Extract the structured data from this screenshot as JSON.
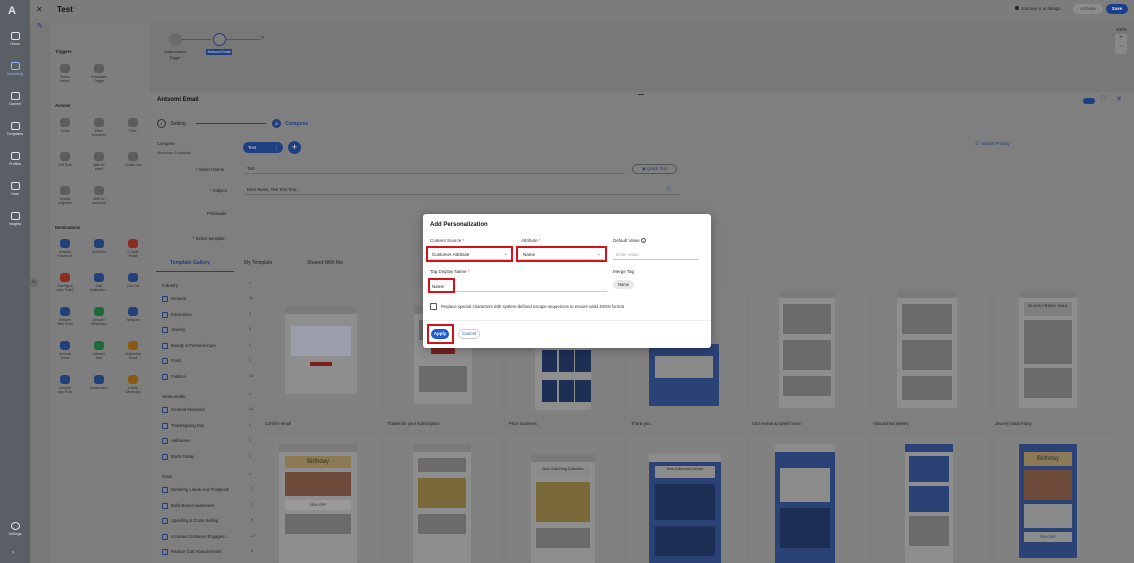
{
  "rail": {
    "items": [
      {
        "label": "Home",
        "icon": "home-icon"
      },
      {
        "label": "Marketing",
        "icon": "marketing-icon",
        "active": true
      },
      {
        "label": "Content",
        "icon": "content-icon"
      },
      {
        "label": "Templates",
        "icon": "templates-icon"
      },
      {
        "label": "Profiles",
        "icon": "profiles-icon"
      },
      {
        "label": "Data",
        "icon": "data-icon"
      },
      {
        "label": "Insights",
        "icon": "insights-icon"
      }
    ],
    "settings_label": "Settings"
  },
  "header": {
    "title": "Test",
    "tooltip": "Test",
    "status": "Journey is in design",
    "activate_label": "Activate",
    "save_label": "Save",
    "zoom": "100%"
  },
  "canvas_nodes": [
    {
      "label": "Action Based\nTrigger"
    },
    {
      "label": "Antsomi Email"
    }
  ],
  "palette": {
    "triggers_title": "Triggers",
    "triggers": [
      "Action\nbased",
      "Scheduled\nTrigger"
    ],
    "actions_title": "Actions",
    "actions": [
      "Delay",
      "Either\nbranches",
      "Filter",
      "A/B Split",
      "Wait for\nevent",
      "Update info",
      "Update\nsegment",
      "Wait for\nresponse"
    ],
    "destinations_title": "Destinations",
    "destinations": [
      "Antsomi\nFacebook",
      "SendGrid",
      "G Suite\nEmail",
      "OneSignal\n(App Push)",
      "Zalo\nNotificatio...",
      "Zalo OA",
      "Antsomi\nWeb Push",
      "Antsomi\nWhatsApp",
      "Telegram",
      "Antsomi\nEmail",
      "Antsomi\nLine",
      "Mailchimp\nEmail",
      "Antsomi\nApp Push",
      "Smart Inbox",
      "Infobip\nWhatsapp"
    ]
  },
  "email_panel": {
    "title": "Antsomi Email",
    "step1": "Setting",
    "step2": "Compose",
    "compose_label": "Compose",
    "compose_sub": "Maximum 5 variants",
    "variant_tab": "Test",
    "variant_priority": "Variant Priority",
    "variant_name_label": "* Variant Name",
    "variant_name_value": "Test",
    "quick_test": "Quick Test",
    "subject_label": "* Subject",
    "subject_value": "Dear Name, Test Test Test...",
    "preheader_label": "Preheader",
    "select_template_label": "* Select template",
    "tabs": [
      "Template Gallery",
      "My Template",
      "Shared With Me"
    ]
  },
  "filters": {
    "industry_title": "Industry",
    "industry": [
      {
        "label": "General",
        "count": "10"
      },
      {
        "label": "Electronics",
        "count": "1"
      },
      {
        "label": "Jewelry",
        "count": "3"
      },
      {
        "label": "Beauty & Personal Care",
        "count": "1"
      },
      {
        "label": "Food",
        "count": "1"
      },
      {
        "label": "Fashion",
        "count": "10"
      }
    ],
    "seasonality_title": "Seasonality",
    "seasonality": [
      {
        "label": "General Seasonal",
        "count": "24"
      },
      {
        "label": "Thanksgiving Day",
        "count": "1"
      },
      {
        "label": "Halloween",
        "count": "1"
      },
      {
        "label": "Black Friday",
        "count": "1"
      }
    ],
    "goal_title": "Goal",
    "goal": [
      {
        "label": "Nurturing Leads And Prospects",
        "count": "7"
      },
      {
        "label": "Build Brand Awareness",
        "count": "7"
      },
      {
        "label": "Upselling & Cross-Selling",
        "count": "9"
      },
      {
        "label": "Increase Customer Engagem...",
        "count": "17"
      },
      {
        "label": "Reduce Cart Abandonment",
        "count": "5"
      }
    ]
  },
  "templates_row1": [
    "Confirm email",
    "Thanks for your subscription",
    "Price madness",
    "Thank you",
    "Cart revival & upsell boost",
    "Abandoned jewelry",
    "Jewelry black friday"
  ],
  "thumb_texts": {
    "black_friday": "BLACK FRIDAY SALE",
    "birthday": "Birthday",
    "gold_ring": "New Gold Ring Collection",
    "new_collection": "New Collection Launch",
    "off_25": "25% OFF",
    "off_75": "75% OFF"
  },
  "modal": {
    "title": "Add Personalization",
    "content_source_label": "Content Source",
    "content_source_value": "Customer Attribute",
    "attribute_label": "Attribute",
    "attribute_value": "Name",
    "default_value_label": "Default Value",
    "default_value_placeholder": "Enter value",
    "tag_display_label": "Tag Display Name",
    "tag_display_value": "Name",
    "merge_tag_label": "Merge Tag",
    "merge_tag_value": "Name",
    "escape_label": "Replace special characters with system-defined escape sequences to ensure valid JSON format",
    "apply_label": "Apply",
    "cancel_label": "Cancel",
    "highlight_color": "#d8101a",
    "primary_color": "#1f5cd1"
  }
}
